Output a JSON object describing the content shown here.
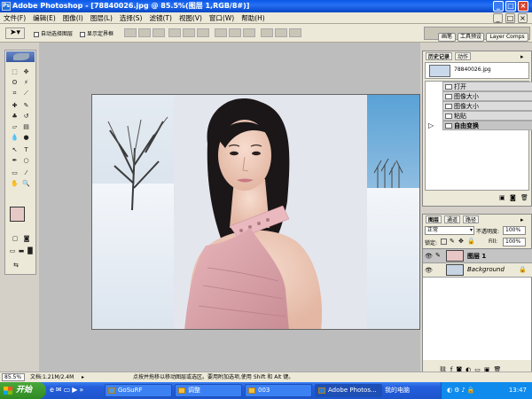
{
  "window": {
    "title": "Adobe Photoshop - [78840026.jpg @ 85.5%(图层 1,RGB/8#)]"
  },
  "menu": [
    "文件(F)",
    "编辑(E)",
    "图像(I)",
    "图层(L)",
    "选择(S)",
    "滤镜(T)",
    "视图(V)",
    "窗口(W)",
    "帮助(H)"
  ],
  "options": {
    "auto_select": "自动选择图层",
    "show_bounds": "显示定界框"
  },
  "palette_well": {
    "tabs": [
      "画笔",
      "工具预设",
      "Layer Comps"
    ]
  },
  "history": {
    "tabs": [
      "历史记录",
      "动作"
    ],
    "snapshot": "78840026.jpg",
    "items": [
      "打开",
      "图像大小",
      "图像大小",
      "粘贴",
      "自由变换"
    ]
  },
  "layers": {
    "tabs": [
      "图层",
      "通道",
      "路径"
    ],
    "blend_mode": "正常",
    "opacity_label": "不透明度:",
    "opacity": "100%",
    "lock_label": "锁定:",
    "fill_label": "Fill:",
    "fill": "100%",
    "items": [
      {
        "name": "图层 1",
        "selected": true
      },
      {
        "name": "Background",
        "locked": true
      }
    ]
  },
  "status": {
    "zoom": "85.5%",
    "doc_size": "文档:1.21M/2.4M",
    "hint": "点按并拖移以移动图层或选区。要用附加选项,使用 Shift 和 Alt 键。"
  },
  "taskbar": {
    "start": "开始",
    "tasks": [
      "GoSuRF",
      "调整",
      "003",
      "Adobe Photos..."
    ],
    "tray_text": "我的电脑",
    "clock": "13:47"
  },
  "colors": {
    "title_blue": "#0a58e8",
    "selection_highlight": "#c4c4c4",
    "taskbar_blue": "#245edb",
    "start_green": "#3a9a2c"
  }
}
